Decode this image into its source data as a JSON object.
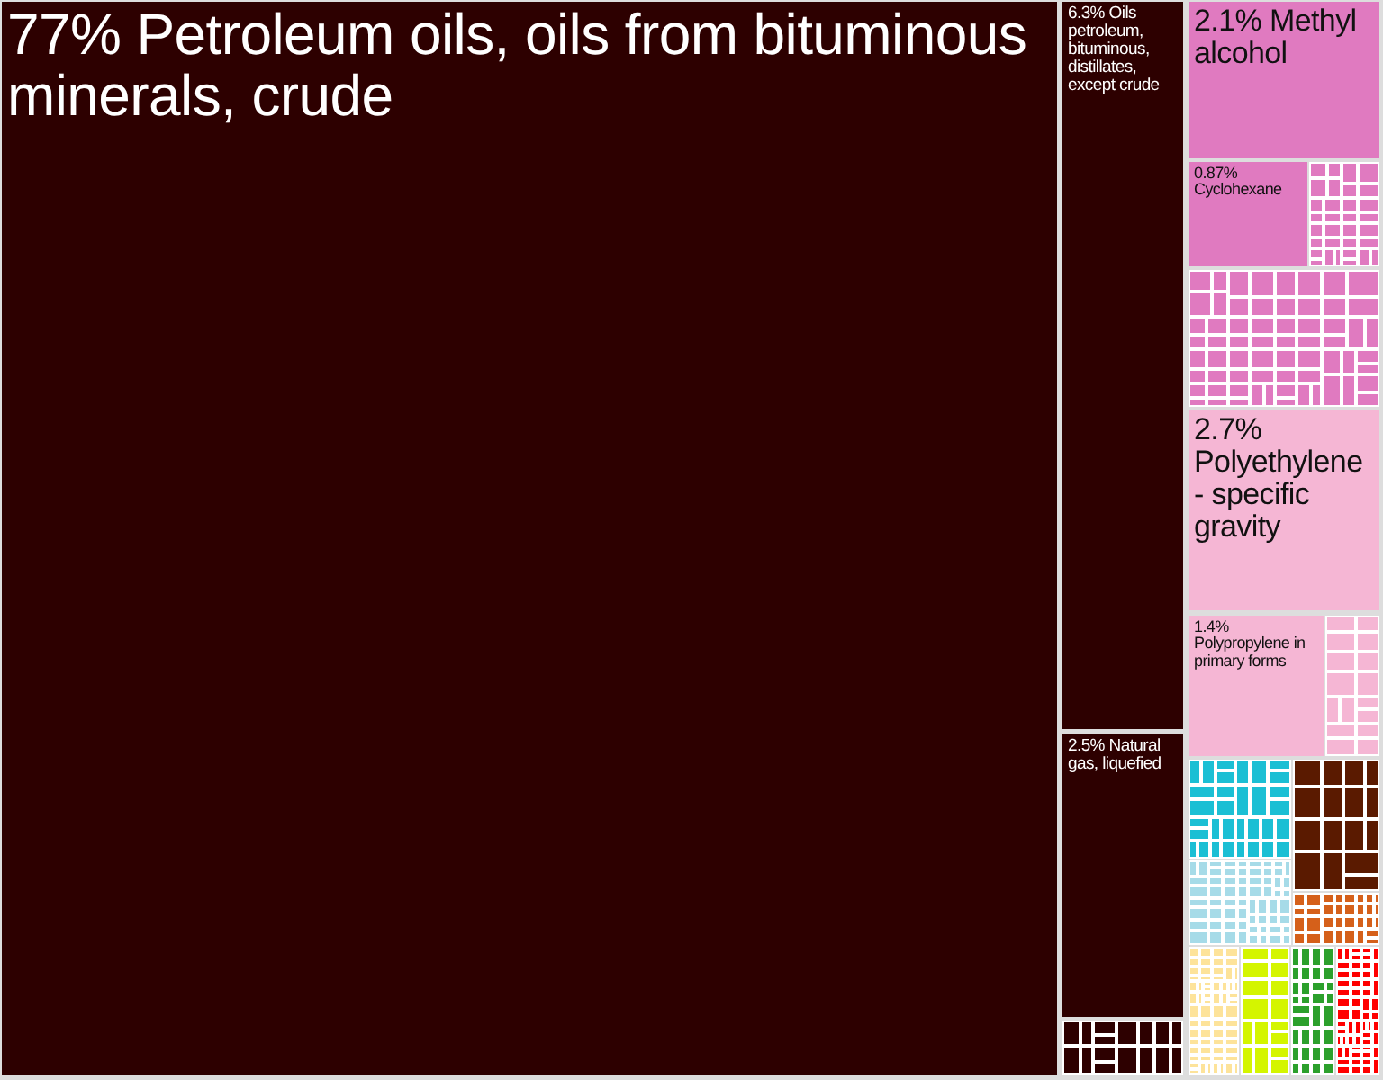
{
  "treemap": {
    "tiles": [
      {
        "label": "77% Petroleum oils, oils from bituminous minerals, crude",
        "color": "#2d0000"
      },
      {
        "label": "6.3% Oils petroleum, bituminous, distillates, except crude",
        "color": "#2d0000"
      },
      {
        "label": "2.5% Natural gas, liquefied",
        "color": "#2d0000"
      },
      {
        "label": "2.1% Methyl alcohol",
        "color": "#e07ac0"
      },
      {
        "label": "0.87% Cyclohexane",
        "color": "#e07ac0"
      },
      {
        "label": "2.7% Polyethylene - specific gravity",
        "color": "#f5b6d4"
      },
      {
        "label": "1.4% Polypropylene in primary forms",
        "color": "#f5b6d4"
      }
    ],
    "groups": [
      {
        "color": "#2d0000"
      },
      {
        "color": "#e07ac0"
      },
      {
        "color": "#e07ac0"
      },
      {
        "color": "#f5b6d4"
      },
      {
        "color": "#1bbfd4"
      },
      {
        "color": "#a6dbe8"
      },
      {
        "color": "#5a1a00"
      },
      {
        "color": "#d5601a"
      },
      {
        "color": "#fde39a"
      },
      {
        "color": "#d4f500"
      },
      {
        "color": "#2ca02c"
      },
      {
        "color": "#ff0000"
      }
    ]
  }
}
